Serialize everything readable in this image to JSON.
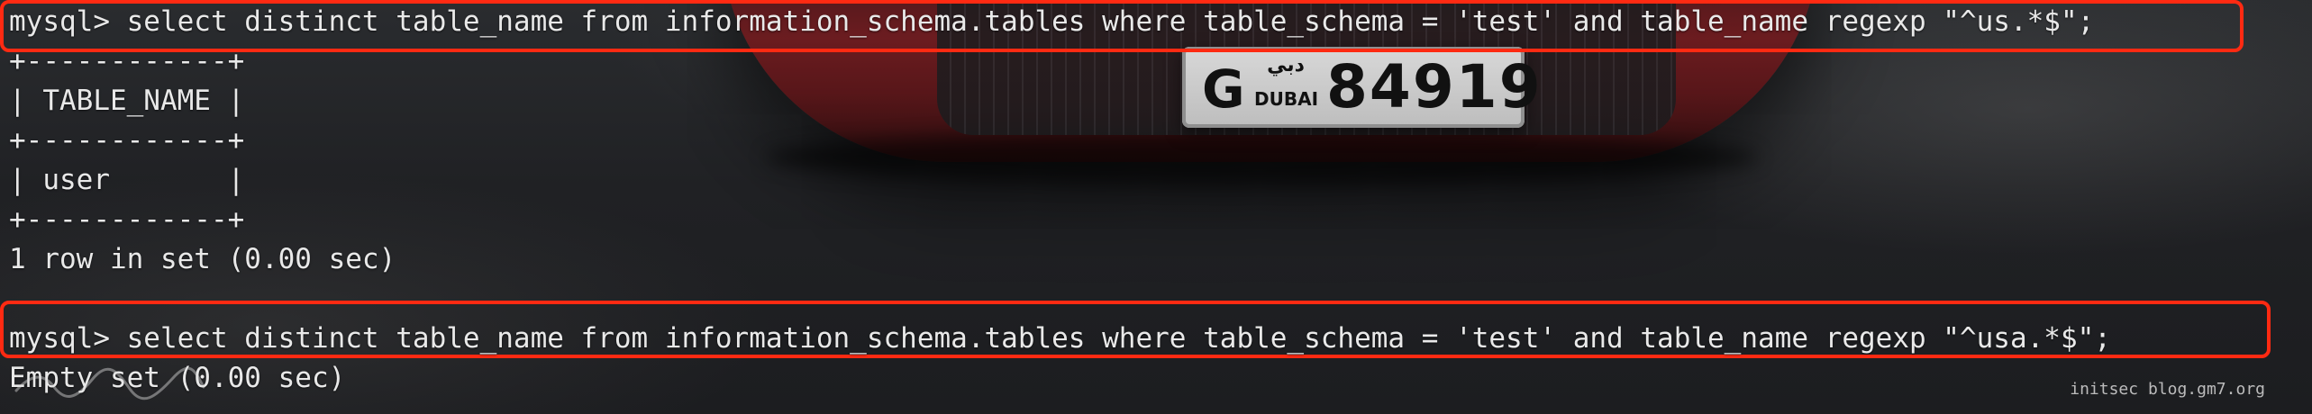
{
  "background": {
    "plate": {
      "letter": "G",
      "arabic_text": "دبي",
      "city": "DUBAI",
      "number": "84919"
    }
  },
  "terminal": {
    "lines": [
      "mysql> select distinct table_name from information_schema.tables where table_schema = 'test' and table_name regexp \"^us.*$\";",
      "+------------+",
      "| TABLE_NAME |",
      "+------------+",
      "| user       |",
      "+------------+",
      "1 row in set (0.00 sec)",
      "",
      "mysql> select distinct table_name from information_schema.tables where table_schema = 'test' and table_name regexp \"^usa.*$\";",
      "Empty set (0.00 sec)"
    ]
  },
  "watermark": "initsec blog.gm7.org",
  "colors": {
    "highlight": "#ff2a12",
    "text": "#e9e9e9"
  }
}
